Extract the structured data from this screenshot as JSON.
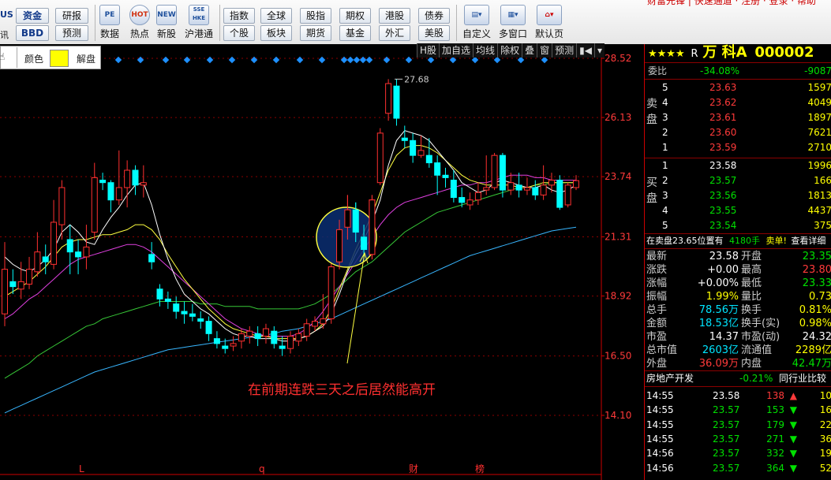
{
  "toolbar": {
    "top_partial": "财富先锋 | 快速通道 · 注册 · 登录 · 帮助",
    "left_buttons": [
      {
        "top": "资金",
        "bottom": "BBD"
      },
      {
        "top": "研报",
        "bottom": "预测"
      }
    ],
    "icon_buttons": [
      {
        "icon": "PE",
        "label": "数据"
      },
      {
        "icon": "HOT",
        "label": "热点"
      },
      {
        "icon": "NEW",
        "label": "新股"
      },
      {
        "icon": "SSE HKE",
        "label": "沪港通"
      }
    ],
    "market_buttons_row1": [
      "指数",
      "全球",
      "股指",
      "期权",
      "港股",
      "债券"
    ],
    "market_buttons_row2": [
      "个股",
      "板块",
      "期货",
      "基金",
      "外汇",
      "美股"
    ],
    "right_buttons": [
      "自定义",
      "多窗口",
      "默认页"
    ],
    "partial_left": [
      "US",
      "讯"
    ]
  },
  "popup": {
    "color_label": "颜色",
    "unlock_label": "解盘"
  },
  "chart_tools": [
    "H股",
    "加自选",
    "均线",
    "除权",
    "叠",
    "窗",
    "预测",
    "▮◀",
    "▾"
  ],
  "chart_data": {
    "type": "candlestick",
    "price_axis": [
      "28.52",
      "26.13",
      "23.74",
      "21.31",
      "18.92",
      "16.50",
      "14.10"
    ],
    "ylim": [
      14.1,
      28.52
    ],
    "high_marker": "27.68",
    "annotation": "在前期连跌三天之后居然能高开",
    "bottom_markers": [
      "L",
      "q",
      "财",
      "榜"
    ],
    "candles": [
      {
        "o": 18.2,
        "c": 20.0,
        "h": 21.1,
        "l": 17.7
      },
      {
        "o": 19.5,
        "c": 19.3,
        "h": 20.0,
        "l": 19.0
      },
      {
        "o": 19.2,
        "c": 19.5,
        "h": 20.3,
        "l": 18.8
      },
      {
        "o": 19.4,
        "c": 20.0,
        "h": 20.5,
        "l": 19.2
      },
      {
        "o": 19.9,
        "c": 20.7,
        "h": 21.5,
        "l": 19.7
      },
      {
        "o": 20.5,
        "c": 20.3,
        "h": 21.0,
        "l": 19.8
      },
      {
        "o": 20.2,
        "c": 21.9,
        "h": 22.8,
        "l": 20.0
      },
      {
        "o": 21.8,
        "c": 23.3,
        "h": 23.6,
        "l": 21.2
      },
      {
        "o": 21.2,
        "c": 20.7,
        "h": 21.8,
        "l": 19.8
      },
      {
        "o": 20.7,
        "c": 20.5,
        "h": 21.2,
        "l": 19.8
      },
      {
        "o": 20.5,
        "c": 20.9,
        "h": 21.8,
        "l": 20.0
      },
      {
        "o": 21.5,
        "c": 23.7,
        "h": 24.3,
        "l": 21.2
      },
      {
        "o": 23.6,
        "c": 23.5,
        "h": 23.9,
        "l": 23.2
      },
      {
        "o": 23.5,
        "c": 22.8,
        "h": 23.6,
        "l": 22.3
      },
      {
        "o": 22.8,
        "c": 23.3,
        "h": 24.8,
        "l": 22.6
      },
      {
        "o": 23.3,
        "c": 24.0,
        "h": 24.4,
        "l": 22.5
      },
      {
        "o": 24.0,
        "c": 23.4,
        "h": 24.2,
        "l": 23.0
      },
      {
        "o": 23.4,
        "c": 23.5,
        "h": 24.2,
        "l": 22.9
      },
      {
        "o": 20.6,
        "c": 20.3,
        "h": 21.1,
        "l": 20.0
      },
      {
        "o": 19.2,
        "c": 18.8,
        "h": 19.4,
        "l": 18.5
      },
      {
        "o": 18.8,
        "c": 18.7,
        "h": 19.1,
        "l": 18.4
      },
      {
        "o": 18.6,
        "c": 18.3,
        "h": 18.9,
        "l": 18.0
      },
      {
        "o": 18.3,
        "c": 18.2,
        "h": 18.7,
        "l": 17.8
      },
      {
        "o": 18.2,
        "c": 18.1,
        "h": 18.6,
        "l": 17.9
      },
      {
        "o": 18.0,
        "c": 17.9,
        "h": 18.3,
        "l": 17.6
      },
      {
        "o": 17.9,
        "c": 17.4,
        "h": 18.1,
        "l": 17.1
      },
      {
        "o": 17.2,
        "c": 17.0,
        "h": 17.5,
        "l": 16.8
      },
      {
        "o": 16.9,
        "c": 16.8,
        "h": 17.2,
        "l": 16.6
      },
      {
        "o": 16.9,
        "c": 17.0,
        "h": 17.3,
        "l": 16.7
      },
      {
        "o": 17.1,
        "c": 17.4,
        "h": 17.6,
        "l": 16.8
      },
      {
        "o": 17.3,
        "c": 17.5,
        "h": 17.7,
        "l": 17.0
      },
      {
        "o": 17.4,
        "c": 17.2,
        "h": 17.7,
        "l": 16.9
      },
      {
        "o": 17.3,
        "c": 17.6,
        "h": 17.8,
        "l": 17.0
      },
      {
        "o": 17.5,
        "c": 17.0,
        "h": 17.7,
        "l": 16.8
      },
      {
        "o": 16.9,
        "c": 16.8,
        "h": 17.3,
        "l": 16.5
      },
      {
        "o": 16.8,
        "c": 17.3,
        "h": 17.5,
        "l": 16.6
      },
      {
        "o": 17.1,
        "c": 17.4,
        "h": 17.6,
        "l": 16.9
      },
      {
        "o": 17.3,
        "c": 17.8,
        "h": 18.0,
        "l": 17.1
      },
      {
        "o": 17.7,
        "c": 17.9,
        "h": 18.1,
        "l": 17.5
      },
      {
        "o": 17.8,
        "c": 18.0,
        "h": 19.0,
        "l": 17.6
      },
      {
        "o": 18.0,
        "c": 20.1,
        "h": 20.3,
        "l": 17.8
      },
      {
        "o": 20.3,
        "c": 21.6,
        "h": 22.0,
        "l": 20.0
      },
      {
        "o": 21.7,
        "c": 22.4,
        "h": 23.0,
        "l": 21.2
      },
      {
        "o": 22.4,
        "c": 21.5,
        "h": 22.7,
        "l": 21.1
      },
      {
        "o": 21.3,
        "c": 20.8,
        "h": 21.8,
        "l": 20.5
      },
      {
        "o": 20.6,
        "c": 22.8,
        "h": 23.0,
        "l": 20.4
      },
      {
        "o": 23.5,
        "c": 25.5,
        "h": 25.7,
        "l": 23.4
      },
      {
        "o": 26.3,
        "c": 27.5,
        "h": 27.68,
        "l": 26.0
      },
      {
        "o": 27.4,
        "c": 26.1,
        "h": 27.68,
        "l": 25.8
      },
      {
        "o": 25.3,
        "c": 25.2,
        "h": 25.8,
        "l": 24.9
      },
      {
        "o": 25.2,
        "c": 24.6,
        "h": 25.5,
        "l": 24.3
      },
      {
        "o": 24.6,
        "c": 24.8,
        "h": 25.4,
        "l": 24.5
      },
      {
        "o": 24.6,
        "c": 24.3,
        "h": 25.3,
        "l": 24.1
      },
      {
        "o": 24.3,
        "c": 23.8,
        "h": 24.6,
        "l": 23.0
      },
      {
        "o": 23.8,
        "c": 23.7,
        "h": 24.1,
        "l": 23.3
      },
      {
        "o": 23.6,
        "c": 22.9,
        "h": 24.0,
        "l": 22.7
      },
      {
        "o": 22.9,
        "c": 22.7,
        "h": 23.3,
        "l": 22.5
      },
      {
        "o": 22.6,
        "c": 22.8,
        "h": 23.1,
        "l": 22.4
      },
      {
        "o": 22.8,
        "c": 23.1,
        "h": 23.5,
        "l": 22.6
      },
      {
        "o": 23.2,
        "c": 23.3,
        "h": 24.6,
        "l": 23.0
      },
      {
        "o": 23.3,
        "c": 24.6,
        "h": 24.7,
        "l": 23.2
      },
      {
        "o": 24.6,
        "c": 23.2,
        "h": 24.7,
        "l": 22.9
      },
      {
        "o": 23.2,
        "c": 23.5,
        "h": 23.9,
        "l": 23.0
      },
      {
        "o": 23.4,
        "c": 23.2,
        "h": 23.9,
        "l": 22.9
      },
      {
        "o": 23.2,
        "c": 23.3,
        "h": 23.7,
        "l": 23.0
      },
      {
        "o": 23.3,
        "c": 23.0,
        "h": 23.6,
        "l": 22.8
      },
      {
        "o": 23.0,
        "c": 23.4,
        "h": 24.2,
        "l": 22.8
      },
      {
        "o": 23.4,
        "c": 23.6,
        "h": 23.9,
        "l": 23.1
      },
      {
        "o": 23.6,
        "c": 22.5,
        "h": 23.8,
        "l": 22.4
      },
      {
        "o": 22.6,
        "c": 23.4,
        "h": 23.5,
        "l": 22.5
      },
      {
        "o": 23.3,
        "c": 23.58,
        "h": 23.8,
        "l": 23.2
      }
    ],
    "ma_white": [
      20.5,
      20.2,
      20.0,
      19.9,
      20.1,
      20.4,
      20.8,
      21.5,
      21.8,
      21.5,
      21.1,
      21.0,
      21.6,
      22.1,
      22.5,
      23.0,
      23.4,
      23.5,
      22.6,
      21.4,
      20.4,
      19.6,
      19.0,
      18.7,
      18.4,
      18.2,
      17.9,
      17.6,
      17.4,
      17.3,
      17.3,
      17.2,
      17.2,
      17.2,
      17.1,
      17.1,
      17.2,
      17.3,
      17.5,
      17.7,
      18.2,
      19.0,
      19.9,
      20.6,
      21.2,
      21.9,
      22.8,
      24.2,
      25.2,
      25.6,
      25.5,
      25.4,
      25.2,
      24.8,
      24.4,
      24.0,
      23.5,
      23.3,
      23.1,
      23.2,
      23.5,
      23.6,
      23.5,
      23.4,
      23.3,
      23.3,
      23.4,
      23.2,
      23.1,
      23.2,
      23.4
    ],
    "ma_yellow": [
      18.9,
      19.1,
      19.3,
      19.5,
      19.8,
      20.1,
      20.5,
      20.9,
      21.1,
      21.2,
      21.2,
      21.3,
      21.4,
      21.4,
      21.5,
      21.6,
      21.8,
      21.8,
      21.6,
      21.2,
      20.6,
      20.1,
      19.6,
      19.2,
      18.8,
      18.4,
      18.1,
      17.8,
      17.6,
      17.5,
      17.4,
      17.3,
      17.3,
      17.2,
      17.2,
      17.2,
      17.2,
      17.3,
      17.5,
      17.8,
      18.4,
      19.2,
      20.0,
      20.8,
      21.5,
      22.2,
      23.1,
      24.0,
      24.6,
      24.9,
      25.0,
      25.0,
      24.9,
      24.7,
      24.4,
      24.1,
      23.8,
      23.6,
      23.5,
      23.4,
      23.4,
      23.4,
      23.4,
      23.3,
      23.3,
      23.4,
      23.5,
      23.5,
      23.5,
      23.5,
      23.5
    ],
    "ma_magenta": [
      18.0,
      18.2,
      18.5,
      18.8,
      19.0,
      19.3,
      19.6,
      19.9,
      20.2,
      20.4,
      20.5,
      20.6,
      20.7,
      20.8,
      20.9,
      21.0,
      21.0,
      20.9,
      20.7,
      20.4,
      20.1,
      19.8,
      19.5,
      19.2,
      18.9,
      18.6,
      18.3,
      18.0,
      17.8,
      17.6,
      17.5,
      17.4,
      17.3,
      17.3,
      17.3,
      17.3,
      17.4,
      17.6,
      17.9,
      18.3,
      18.8,
      19.3,
      19.8,
      20.3,
      20.8,
      21.3,
      21.8,
      22.2,
      22.5,
      22.7,
      22.8,
      22.9,
      23.0,
      23.1,
      23.2,
      23.3,
      23.4,
      23.4,
      23.5,
      23.5,
      23.6,
      23.7,
      23.8,
      23.8,
      23.8,
      23.7,
      23.7,
      23.6,
      23.6,
      23.6,
      23.6
    ],
    "ma_green": [
      15.6,
      15.8,
      16.0,
      16.2,
      16.5,
      16.7,
      16.9,
      17.1,
      17.3,
      17.5,
      17.7,
      17.8,
      18.0,
      18.1,
      18.2,
      18.3,
      18.4,
      18.5,
      18.6,
      18.7,
      18.7,
      18.7,
      18.7,
      18.7,
      18.6,
      18.6,
      18.6,
      18.5,
      18.5,
      18.5,
      18.5,
      18.4,
      18.4,
      18.4,
      18.4,
      18.4,
      18.4,
      18.5,
      18.6,
      18.8,
      19.0,
      19.3,
      19.6,
      19.9,
      20.1,
      20.3,
      20.6,
      20.9,
      21.2,
      21.5,
      21.7,
      21.9,
      22.1,
      22.3,
      22.4,
      22.5,
      22.6,
      22.7,
      22.8,
      22.9,
      23.0,
      23.1,
      23.2,
      23.3,
      23.3,
      23.4,
      23.4,
      23.5,
      23.5,
      23.5,
      23.5
    ],
    "ma_cyan": [
      14.2,
      14.35,
      14.5,
      14.65,
      14.8,
      14.95,
      15.1,
      15.25,
      15.4,
      15.55,
      15.7,
      15.85,
      15.95,
      16.05,
      16.15,
      16.25,
      16.35,
      16.45,
      16.55,
      16.65,
      16.75,
      16.8,
      16.85,
      16.9,
      16.95,
      17.0,
      17.05,
      17.1,
      17.15,
      17.2,
      17.25,
      17.3,
      17.35,
      17.4,
      17.5,
      17.55,
      17.6,
      17.7,
      17.8,
      17.9,
      18.0,
      18.15,
      18.3,
      18.45,
      18.6,
      18.75,
      18.9,
      19.05,
      19.2,
      19.35,
      19.5,
      19.65,
      19.8,
      19.95,
      20.1,
      20.25,
      20.4,
      20.55,
      20.65,
      20.75,
      20.85,
      20.95,
      21.05,
      21.15,
      21.25,
      21.35,
      21.45,
      21.55,
      21.6,
      21.65,
      21.7
    ]
  },
  "quote": {
    "stars": "★★★★",
    "r": "R",
    "name": "万 科A",
    "code": "000002",
    "weibi_label": "委比",
    "weibi_value": "-34.08%",
    "weicha_value": "-9087",
    "sell_label": "卖盘",
    "buy_label": "买盘",
    "sells": [
      {
        "n": "5",
        "price": "23.63",
        "vol": "1597"
      },
      {
        "n": "4",
        "price": "23.62",
        "vol": "4049"
      },
      {
        "n": "3",
        "price": "23.61",
        "vol": "1897"
      },
      {
        "n": "2",
        "price": "23.60",
        "vol": "7621"
      },
      {
        "n": "1",
        "price": "23.59",
        "vol": "2710"
      }
    ],
    "buys": [
      {
        "n": "1",
        "price": "23.58",
        "vol": "1996"
      },
      {
        "n": "2",
        "price": "23.57",
        "vol": "166"
      },
      {
        "n": "3",
        "price": "23.56",
        "vol": "1813"
      },
      {
        "n": "4",
        "price": "23.55",
        "vol": "4437"
      },
      {
        "n": "5",
        "price": "23.54",
        "vol": "375"
      }
    ],
    "notice_text": "在卖盘23.65位置有",
    "notice_vol": "4180手",
    "notice_action": "卖单!",
    "notice_link": "查看详细",
    "stats": [
      {
        "l1": "最新",
        "v1": "23.58",
        "l2": "开盘",
        "v2": "23.35"
      },
      {
        "l1": "涨跌",
        "v1": "+0.00",
        "l2": "最高",
        "v2": "23.80"
      },
      {
        "l1": "涨幅",
        "v1": "+0.00%",
        "l2": "最低",
        "v2": "23.33"
      },
      {
        "l1": "振幅",
        "v1": "1.99%",
        "l2": "量比",
        "v2": "0.73"
      },
      {
        "l1": "总手",
        "v1": "78.56万",
        "l2": "换手",
        "v2": "0.81%"
      },
      {
        "l1": "金额",
        "v1": "18.53亿",
        "l2": "换手(实)",
        "v2": "0.98%"
      },
      {
        "l1": "市盈",
        "v1": "14.37",
        "l2": "市盈(动)",
        "v2": "24.32"
      },
      {
        "l1": "总市值",
        "v1": "2603亿",
        "l2": "流通值",
        "v2": "2289亿"
      },
      {
        "l1": "外盘",
        "v1": "36.09万",
        "l2": "内盘",
        "v2": "42.47万"
      }
    ],
    "sector_name": "房地产开发",
    "sector_change": "-0.21%",
    "sector_compare": "同行业比较",
    "ticks": [
      {
        "t": "14:55",
        "p": "23.58",
        "v": "138",
        "dir": "up",
        "n": "10"
      },
      {
        "t": "14:55",
        "p": "23.57",
        "v": "153",
        "dir": "down",
        "n": "16"
      },
      {
        "t": "14:55",
        "p": "23.57",
        "v": "179",
        "dir": "down",
        "n": "22"
      },
      {
        "t": "14:55",
        "p": "23.57",
        "v": "271",
        "dir": "down",
        "n": "36"
      },
      {
        "t": "14:56",
        "p": "23.57",
        "v": "332",
        "dir": "down",
        "n": "19"
      },
      {
        "t": "14:56",
        "p": "23.57",
        "v": "364",
        "dir": "down",
        "n": "52"
      }
    ]
  }
}
